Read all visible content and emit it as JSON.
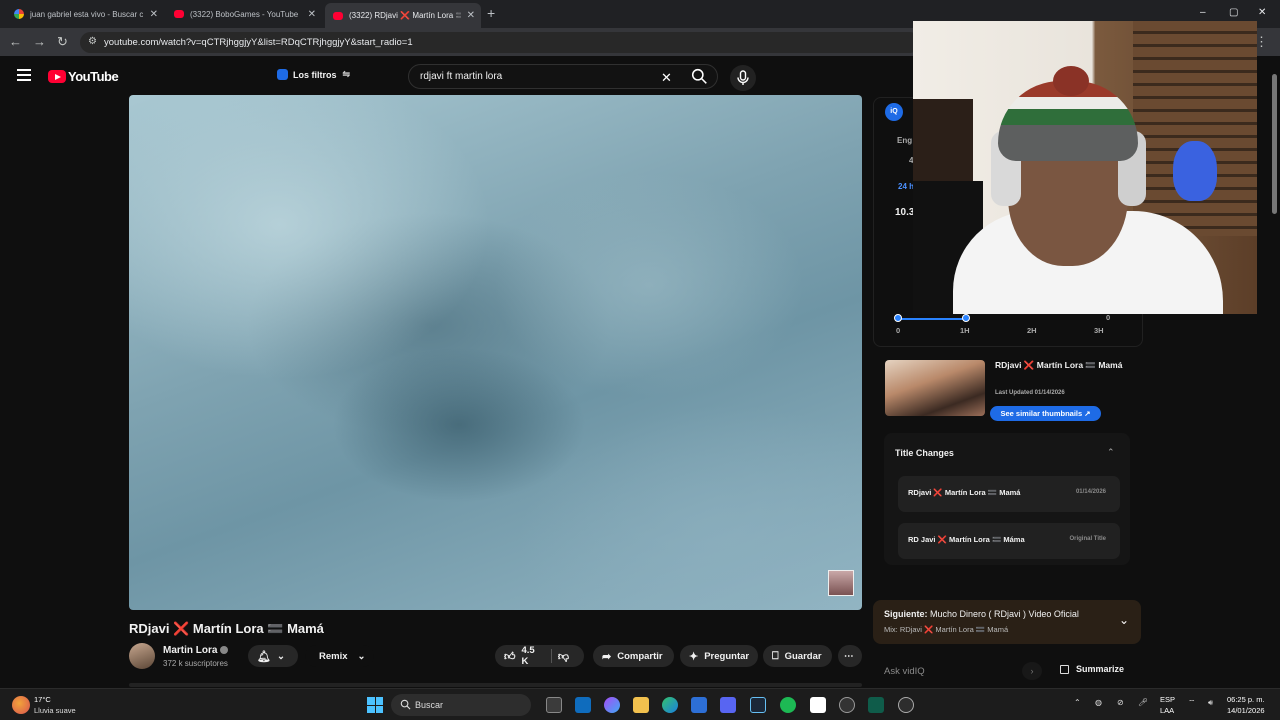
{
  "browser": {
    "tabs": [
      {
        "title": "juan gabriel esta vivo - Buscar c",
        "favicon": "google-icon"
      },
      {
        "title": "(3322) BoboGames - YouTube",
        "favicon": "youtube-icon"
      },
      {
        "title": "(3322) RDjavi ❌ Martín Lora 🟰",
        "favicon": "youtube-icon",
        "active": true
      }
    ],
    "new_tab": "+",
    "url": "youtube.com/watch?v=qCTRjhggjyY&list=RDqCTRjhggjyY&start_radio=1",
    "window_controls": [
      "–",
      "▢",
      "✕"
    ]
  },
  "youtube": {
    "logo_text": "YouTube",
    "filters_label": "Los filtros",
    "search_query": "rdjavi ft martin lora",
    "video": {
      "title": "RDjavi ❌ Martín Lora 🟰 Mamá",
      "channel": "Martin Lora",
      "subscribers": "372 k suscriptores",
      "remix_label": "Remix",
      "likes": "4.5 K",
      "share_label": "Compartir",
      "ask_label": "Preguntar",
      "save_label": "Guardar",
      "more": "⋯"
    }
  },
  "vidiq": {
    "badge": "iQ",
    "partial_labels": [
      "Eng",
      "4",
      "24 h",
      "10.3"
    ],
    "graph": {
      "x_ticks": [
        "0",
        "1H",
        "2H",
        "3H"
      ],
      "end_value": "0"
    },
    "similar": {
      "title": "RDjavi ❌ Martín Lora 🟰 Mamá",
      "last_updated": "Last Updated 01/14/2026",
      "button": "See similar thumbnails ↗"
    },
    "title_changes": {
      "heading": "Title Changes",
      "rows": [
        {
          "title": "RDjavi ❌ Martín Lora 🟰 Mamá",
          "date": "01/14/2026"
        },
        {
          "title": "RD Javi ❌ Martín Lora 🟰 Máma",
          "date": "Original Title"
        }
      ]
    },
    "ask_placeholder": "Ask vidIQ",
    "summarize_label": "Summarize"
  },
  "up_next": {
    "label": "Siguiente:",
    "title": "Mucho Dinero ( RDjavi ) Video Oficial",
    "mix": "Mix: RDjavi ❌ Martín Lora 🟰 Mamá"
  },
  "taskbar": {
    "weather_temp": "17°C",
    "weather_desc": "Lluvia suave",
    "search_label": "Buscar",
    "lang_1": "ESP",
    "lang_2": "LAA",
    "time": "06:25 p. m.",
    "date": "14/01/2026"
  },
  "colors": {
    "youtube_red": "#ff0033",
    "vidiq_blue": "#1e6be6",
    "bg": "#0f0f0f"
  }
}
